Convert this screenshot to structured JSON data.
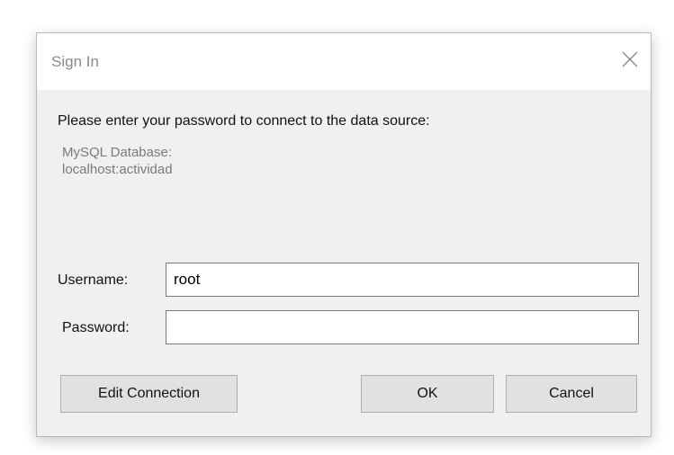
{
  "dialog": {
    "title": "Sign In",
    "close_icon": "close-icon",
    "prompt": "Please enter your password to connect to the data source:",
    "source_line1": "MySQL Database:",
    "source_line2": "localhost:actividad",
    "username_label": "Username:",
    "username_value": "root",
    "password_label": "Password:",
    "password_value": "",
    "edit_connection_label": "Edit Connection",
    "ok_label": "OK",
    "cancel_label": "Cancel"
  }
}
